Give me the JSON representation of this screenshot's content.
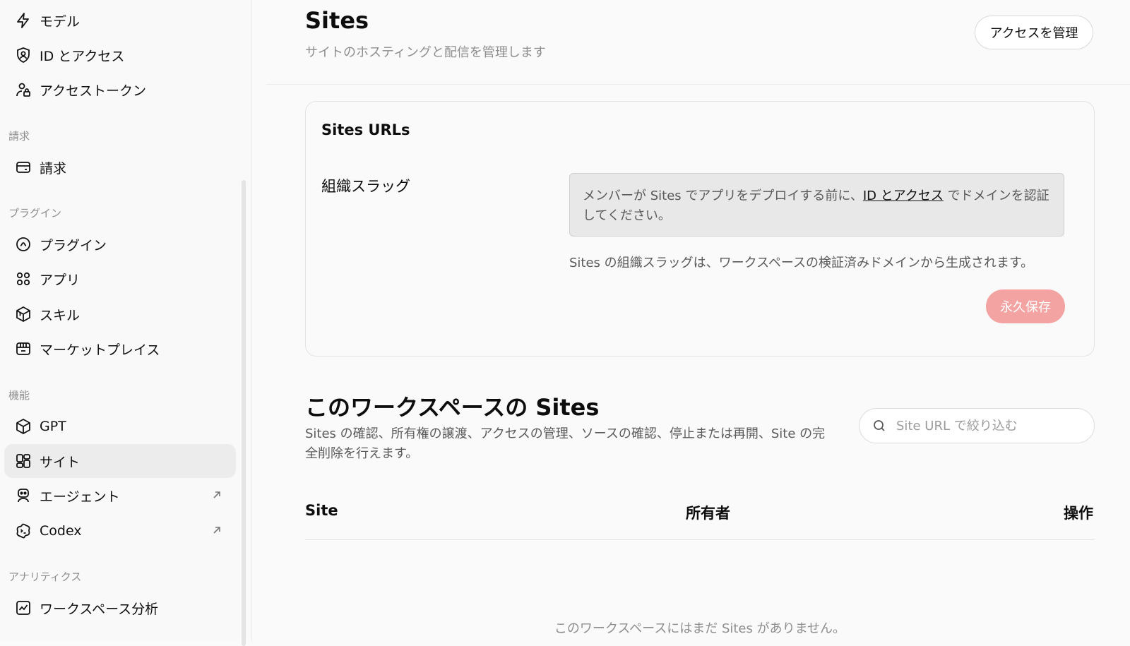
{
  "sidebar": {
    "items_top": [
      {
        "label": "モデル",
        "icon": "bolt-icon"
      },
      {
        "label": "ID とアクセス",
        "icon": "shield-user-icon"
      },
      {
        "label": "アクセストークン",
        "icon": "user-lock-icon"
      }
    ],
    "sections": {
      "billing": "請求",
      "plugins": "プラグイン",
      "features": "機能",
      "analytics": "アナリティクス"
    },
    "billing_items": [
      {
        "label": "請求",
        "icon": "card-icon"
      }
    ],
    "plugin_items": [
      {
        "label": "プラグイン",
        "icon": "plugin-icon"
      },
      {
        "label": "アプリ",
        "icon": "apps-icon"
      },
      {
        "label": "スキル",
        "icon": "cube-stack-icon"
      },
      {
        "label": "マーケットプレイス",
        "icon": "store-icon"
      }
    ],
    "feature_items": [
      {
        "label": "GPT",
        "icon": "cube-icon"
      },
      {
        "label": "サイト",
        "icon": "sites-icon",
        "active": true
      },
      {
        "label": "エージェント",
        "icon": "robot-icon",
        "external": true
      },
      {
        "label": "Codex",
        "icon": "codex-icon",
        "external": true
      }
    ],
    "analytics_items": [
      {
        "label": "ワークスペース分析",
        "icon": "chart-icon"
      }
    ]
  },
  "header": {
    "title": "Sites",
    "subtitle": "サイトのホスティングと配信を管理します",
    "manage_access": "アクセスを管理"
  },
  "card": {
    "title": "Sites URLs",
    "slug_label": "組織スラッグ",
    "notice_pre": "メンバーが Sites でアプリをデプロイする前に、",
    "notice_link": "ID とアクセス",
    "notice_post": " でドメインを認証してください。",
    "help": "Sites の組織スラッグは、ワークスペースの検証済みドメインから生成されます。",
    "save": "永久保存"
  },
  "section": {
    "title": "このワークスペースの Sites",
    "description": "Sites の確認、所有権の譲渡、アクセスの管理、ソースの確認、停止または再開、Site の完全削除を行えます。",
    "filter_placeholder": "Site URL で絞り込む",
    "columns": {
      "site": "Site",
      "owner": "所有者",
      "actions": "操作"
    },
    "empty": "このワークスペースにはまだ Sites がありません。"
  },
  "colors": {
    "accent": "#f4a3a3",
    "active_bg": "#ececec"
  }
}
